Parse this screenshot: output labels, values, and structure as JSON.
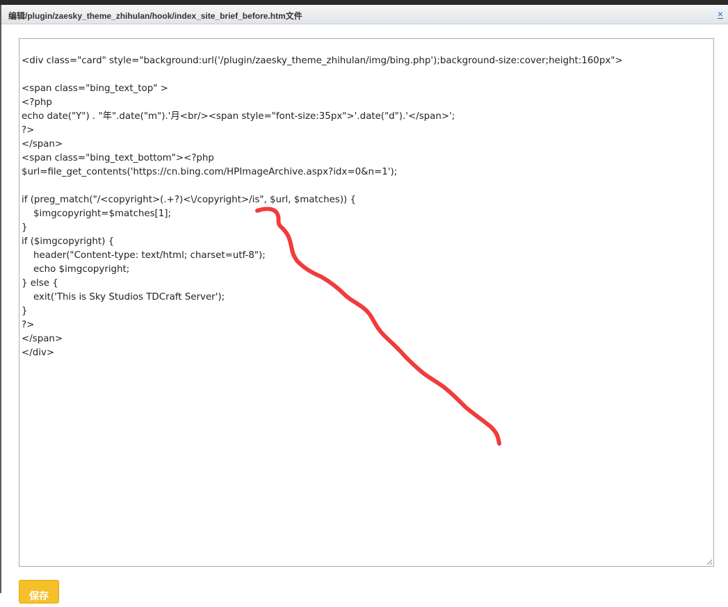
{
  "dialog": {
    "title": "编辑/plugin/zaesky_theme_zhihulan/hook/index_site_brief_before.htm文件",
    "close_label": "×"
  },
  "editor": {
    "lines": [
      "<div class=\"card\" style=\"background:url('/plugin/zaesky_theme_zhihulan/img/bing.php');background-size:cover;height:160px\">",
      "",
      "<span class=\"bing_text_top\" >",
      "<?php",
      "echo date(\"Y\") . \"年\".date(\"m\").'月<br/><span style=\"font-size:35px\">'.date(\"d\").'</span>';",
      "?>",
      "</span>",
      "<span class=\"bing_text_bottom\"><?php",
      "$url=file_get_contents('https://cn.bing.com/HPImageArchive.aspx?idx=0&n=1');",
      "",
      "if (preg_match(\"/<copyright>(.+?)<\\/copyright>/is\", $url, $matches)) {",
      "    $imgcopyright=$matches[1];",
      "}",
      "if ($imgcopyright) {",
      "    header(\"Content-type: text/html; charset=utf-8\");",
      "    echo $imgcopyright;",
      "} else {",
      "    exit('This is Sky Studios TDCraft Server');",
      "}",
      "?>",
      "</span>",
      "</div>"
    ]
  },
  "save_button": {
    "label": "保存"
  },
  "colors": {
    "annotation_stroke": "#f03c3c",
    "save_button_bg": "#f5c02a",
    "title_text": "#333333",
    "close_link": "#1a6fc4"
  }
}
